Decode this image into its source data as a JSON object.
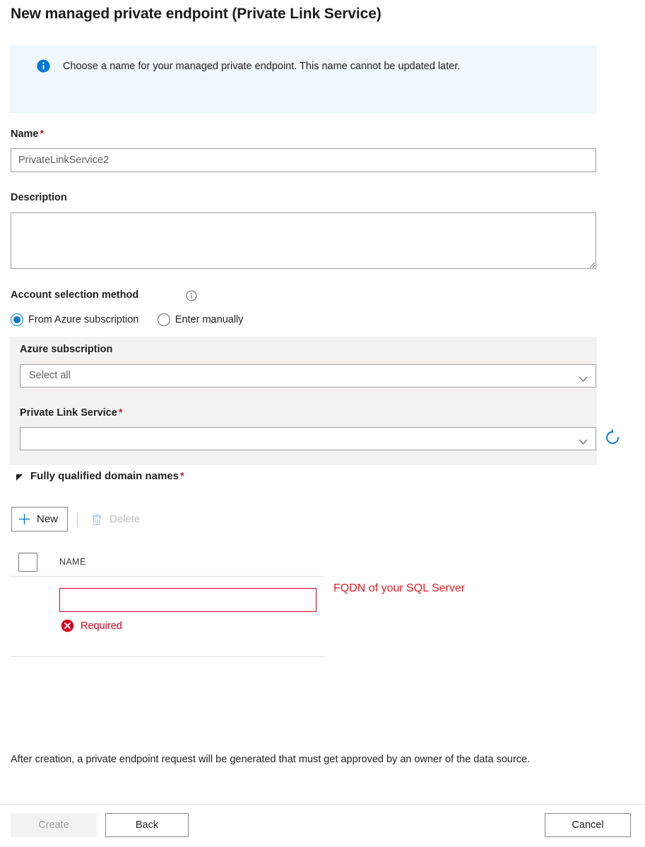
{
  "title": "New managed private endpoint (Private Link Service)",
  "info_banner": {
    "icon": "info-circle-icon",
    "text": "Choose a name for your managed private endpoint. This name cannot be updated later."
  },
  "form": {
    "name": {
      "label": "Name",
      "required_marker": "*",
      "value": "PrivateLinkService2",
      "placeholder": "PrivateLinkService2"
    },
    "description": {
      "label": "Description",
      "value": "",
      "placeholder": ""
    },
    "account_selection": {
      "label": "Account selection method",
      "info_icon": "info-outline-icon",
      "options": [
        {
          "label": "From Azure subscription",
          "selected": true
        },
        {
          "label": "Enter manually",
          "selected": false
        }
      ]
    },
    "azure_subscription": {
      "label": "Azure subscription",
      "value": "Select all",
      "chevron_icon": "chevron-down-icon"
    },
    "private_link_service": {
      "label": "Private Link Service",
      "required_marker": "*",
      "value": "",
      "chevron_icon": "chevron-down-icon",
      "refresh_icon": "refresh-icon"
    }
  },
  "fqdn_section": {
    "caret_icon": "caret-down-icon",
    "title": "Fully qualified domain names",
    "required_marker": "*",
    "toolbar": {
      "new_label": "New",
      "new_icon": "plus-icon",
      "delete_label": "Delete",
      "delete_icon": "trash-icon",
      "delete_disabled": true
    },
    "table": {
      "columns": [
        "NAME"
      ],
      "rows": [
        {
          "name_value": "",
          "error_icon": "error-circle-icon",
          "error_text": "Required"
        }
      ]
    },
    "annotation": "FQDN of your SQL Server"
  },
  "footer": {
    "note": "After creation, a private endpoint request will be generated that must get approved by an owner of the data source.",
    "buttons": {
      "create": "Create",
      "back": "Back",
      "cancel": "Cancel"
    }
  },
  "colors": {
    "accent": "#0078d4",
    "info_bg": "#eff6fc",
    "panel_bg": "#f3f2f1",
    "error": "#d0021b",
    "annotation": "#ee1c25",
    "required_star": "#a4262c"
  }
}
